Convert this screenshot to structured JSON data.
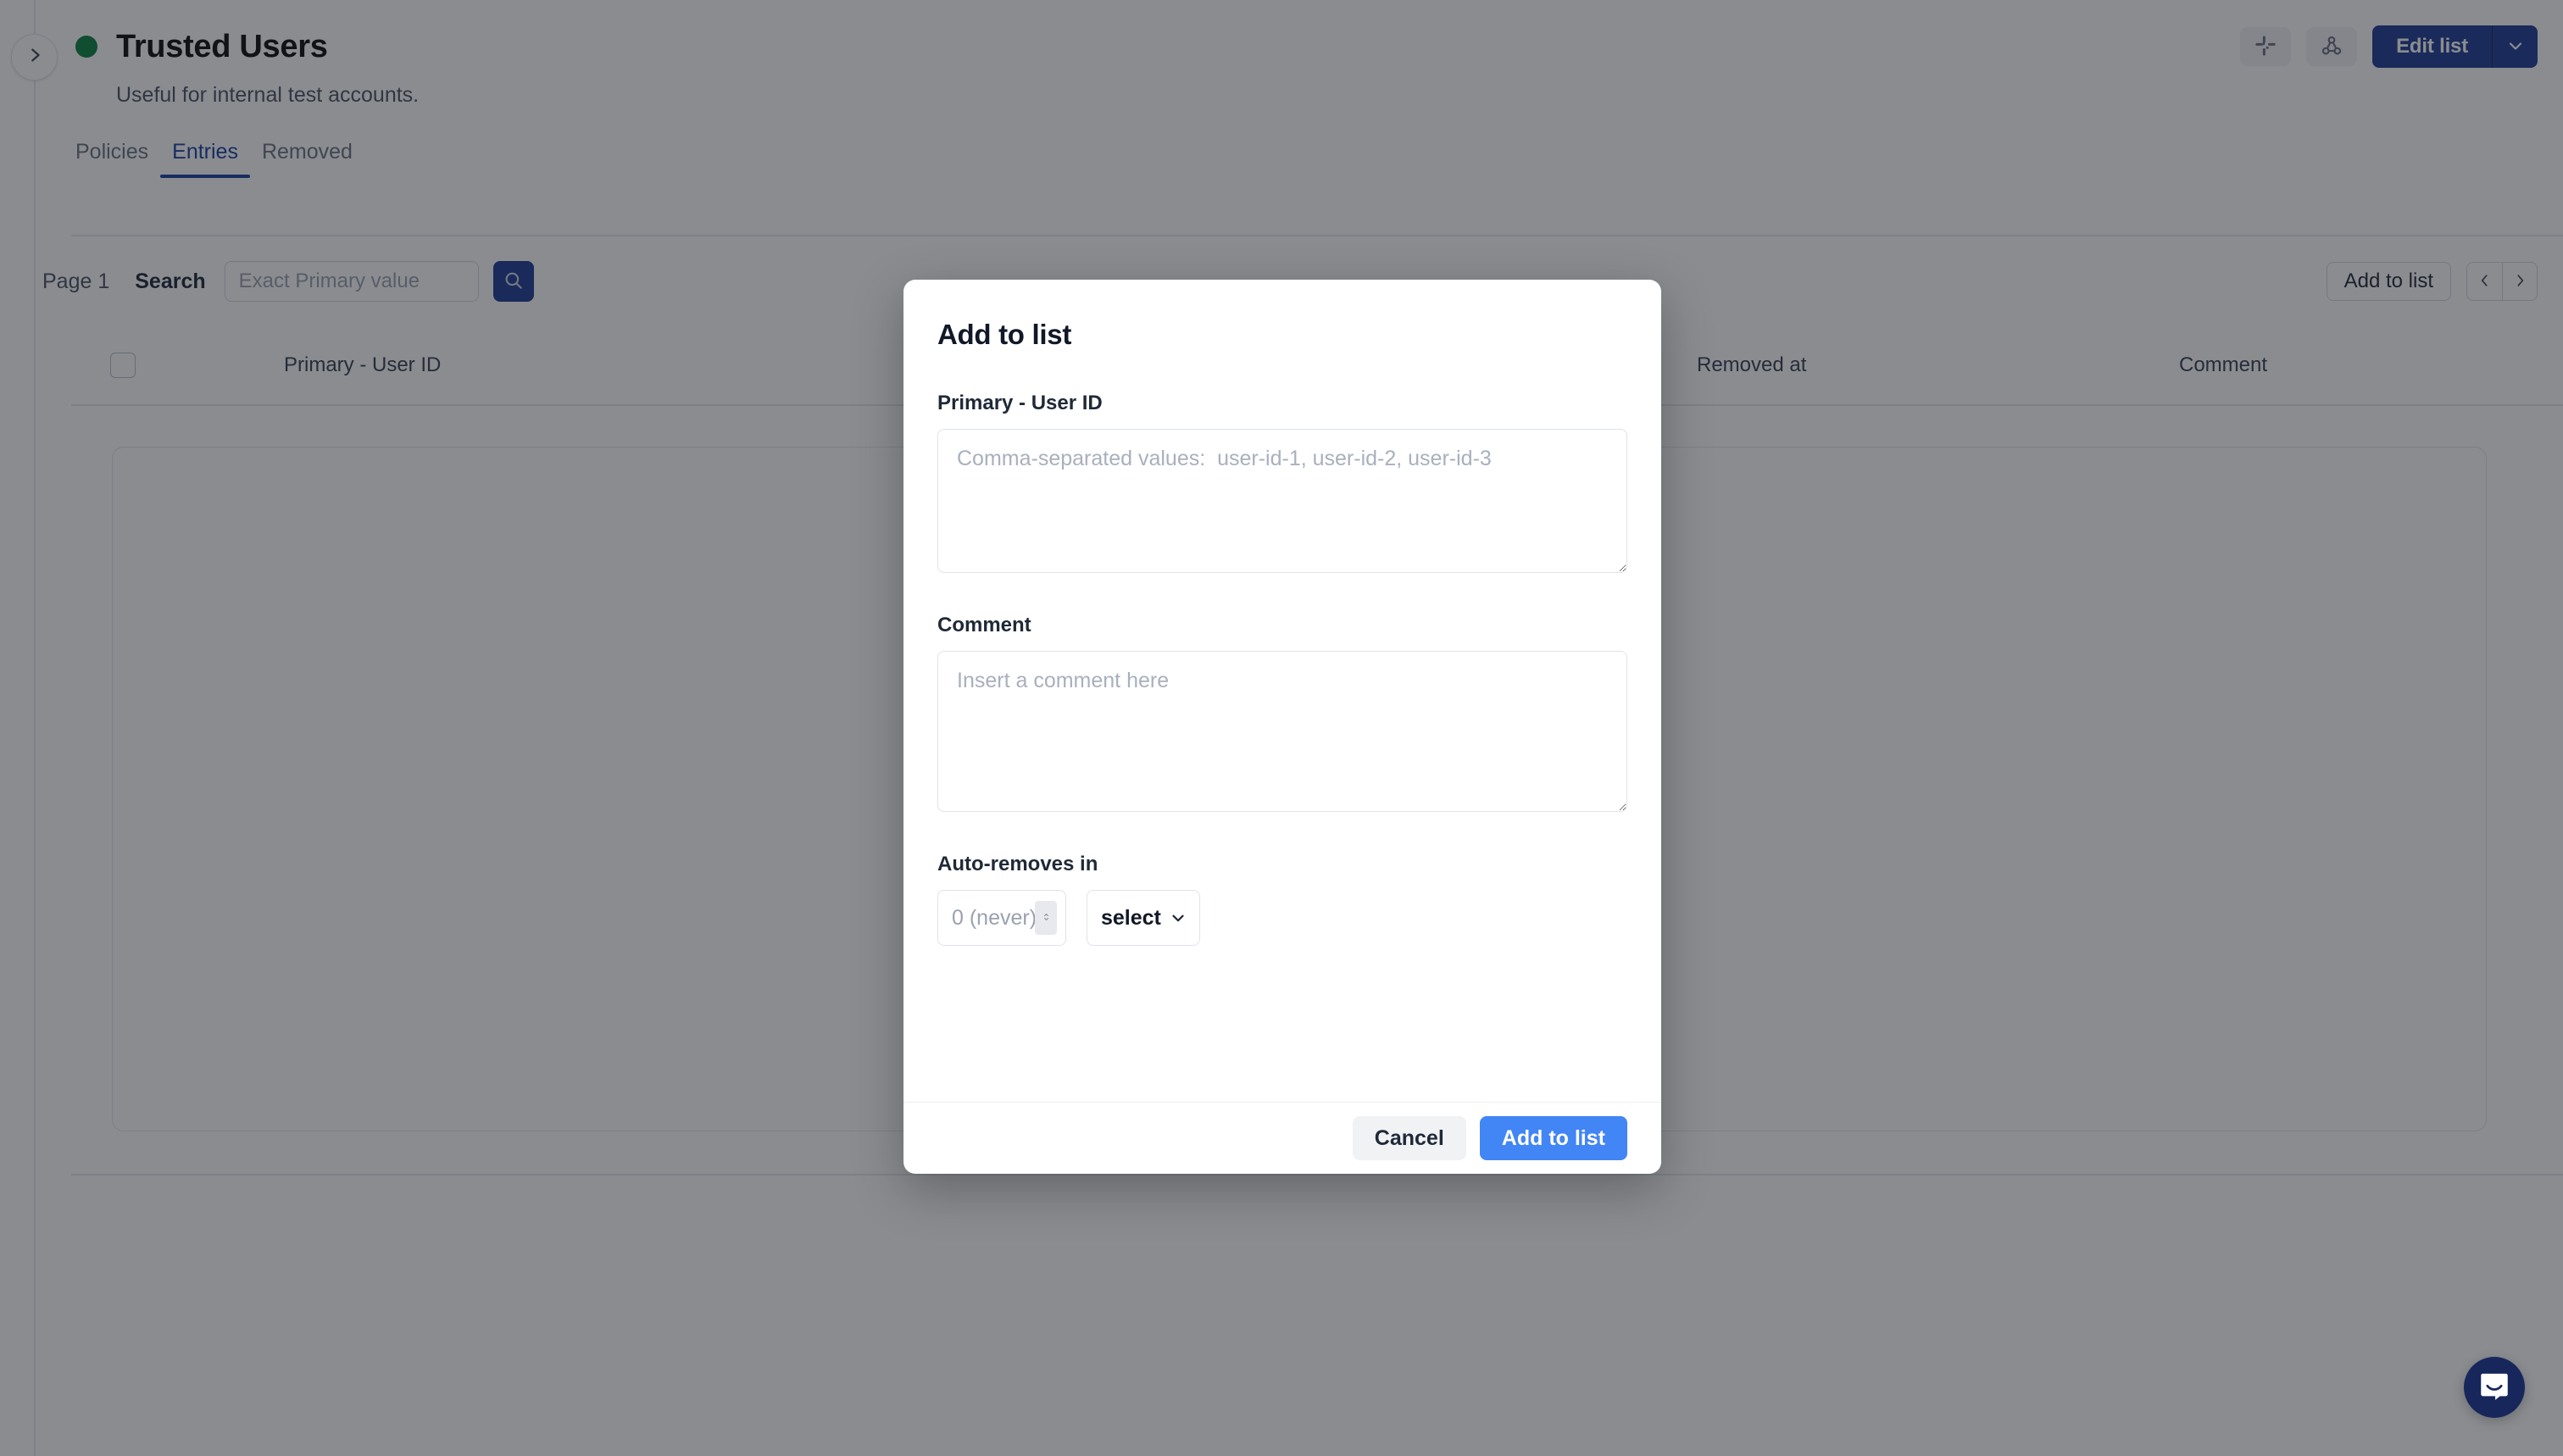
{
  "header": {
    "title": "Trusted Users",
    "subtitle": "Useful for internal test accounts.",
    "status_color": "#0a8040",
    "sidebar_toggle_icon": "chevron-right-icon",
    "actions": {
      "slack_icon": "slack-icon",
      "webhook_icon": "webhook-icon",
      "edit_list_label": "Edit list",
      "edit_list_caret_icon": "chevron-down-icon",
      "edit_list_color": "#1f3a93"
    }
  },
  "tabs": [
    {
      "label": "Policies",
      "active": false
    },
    {
      "label": "Entries",
      "active": true
    },
    {
      "label": "Removed",
      "active": false
    }
  ],
  "toolbar": {
    "page_indicator": "Page 1",
    "search_label": "Search",
    "search_placeholder": "Exact Primary value",
    "search_value": "",
    "search_icon": "search-icon",
    "search_button_color": "#1f3a93",
    "add_to_list_label": "Add to list",
    "prev_icon": "chevron-left-icon",
    "next_icon": "chevron-right-icon"
  },
  "table": {
    "columns": [
      {
        "label": "Primary - User ID"
      },
      {
        "label": "Removed at"
      },
      {
        "label": "Comment"
      }
    ],
    "select_all_checked": false,
    "rows": []
  },
  "modal": {
    "title": "Add to list",
    "primary_field": {
      "label": "Primary - User ID",
      "placeholder": "Comma-separated values:  user-id-1, user-id-2, user-id-3",
      "value": ""
    },
    "comment_field": {
      "label": "Comment",
      "placeholder": "Insert a comment here",
      "value": ""
    },
    "auto_removes_field": {
      "label": "Auto-removes in",
      "amount_placeholder": "0 (never)",
      "amount_value": "",
      "unit_selected": "select",
      "unit_caret_icon": "chevron-down-icon",
      "stepper_icon": "stepper-up-down-icon"
    },
    "footer": {
      "cancel_label": "Cancel",
      "submit_label": "Add to list",
      "submit_color": "#4285f4"
    }
  },
  "messenger": {
    "icon": "intercom-chat-icon",
    "color": "#17275c"
  }
}
